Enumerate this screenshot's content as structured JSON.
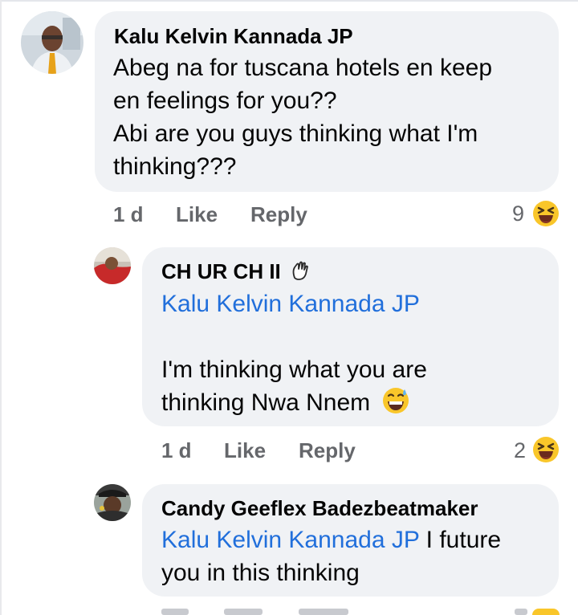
{
  "comments": [
    {
      "author": "Kalu Kelvin Kannada JP",
      "lines": [
        "Abeg na for tuscana hotels en keep",
        "en feelings for you??",
        "Abi are you guys thinking what I'm",
        "thinking???"
      ],
      "time": "1 d",
      "like_label": "Like",
      "reply_label": "Reply",
      "reaction_count": "9",
      "reaction_icon": "laughing-squint-emoji"
    },
    {
      "author": "CH UR CH II",
      "author_badge_icon": "waving-hand-emoji",
      "mention": "Kalu Kelvin Kannada JP",
      "lines": [
        "I'm thinking what you are",
        "thinking Nwa Nnem"
      ],
      "trailing_emoji_icon": "grinning-sweat-emoji",
      "time": "1 d",
      "like_label": "Like",
      "reply_label": "Reply",
      "reaction_count": "2",
      "reaction_icon": "laughing-squint-emoji"
    },
    {
      "author": "Candy Geeflex Badezbeatmaker",
      "mention": "Kalu Kelvin Kannada JP",
      "line1_rest": " I future",
      "line2": "you in this thinking"
    }
  ],
  "colors": {
    "bubble": "#f0f2f5",
    "mention": "#216fdb",
    "meta": "#65676b",
    "emoji": "#f9c62a"
  }
}
